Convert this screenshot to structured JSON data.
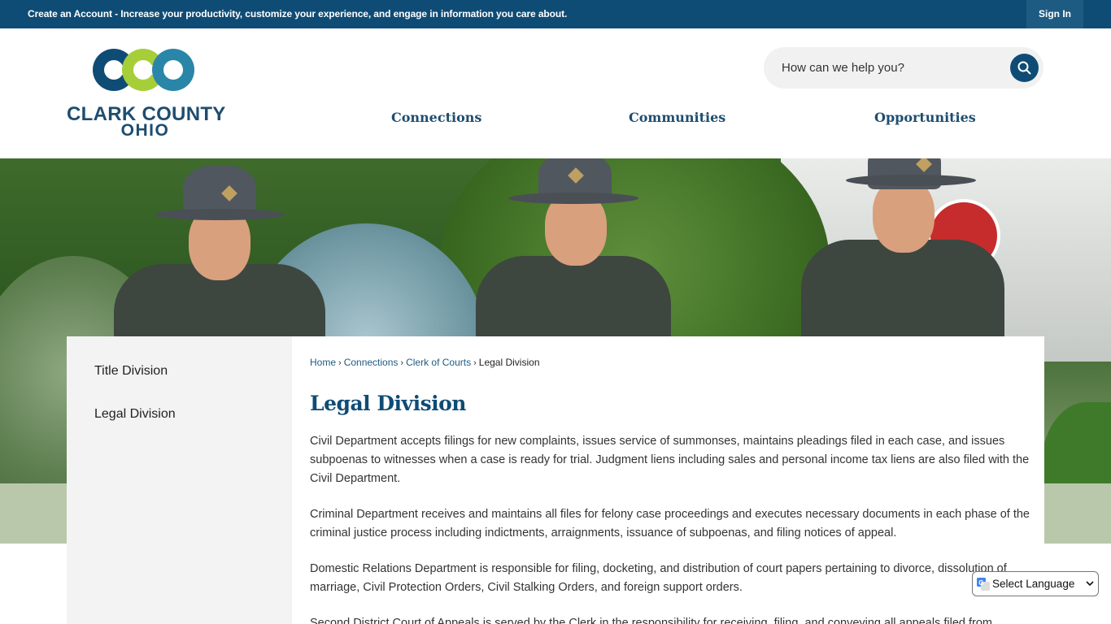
{
  "topbar": {
    "create_account": "Create an Account",
    "account_message": " - Increase your productivity, customize your experience, and engage in information you care about.",
    "sign_in": "Sign In"
  },
  "logo": {
    "line1": "CLARK COUNTY",
    "line2": "OHIO"
  },
  "search": {
    "placeholder": "How can we help you?",
    "icon": "search-icon"
  },
  "nav": {
    "items": [
      "Connections",
      "Communities",
      "Opportunities"
    ]
  },
  "sidebar": {
    "items": [
      "Title Division",
      "Legal Division"
    ]
  },
  "breadcrumb": {
    "items": [
      "Home",
      "Connections",
      "Clerk of Courts"
    ],
    "current": "Legal Division",
    "separator": "›"
  },
  "main": {
    "title": "Legal Division",
    "paragraphs": [
      "Civil Department accepts filings for new complaints, issues service of summonses, maintains pleadings filed in each case, and issues subpoenas to witnesses when a case is ready for trial. Judgment liens including sales and personal income tax liens are also filed with the Civil Department.",
      "Criminal Department receives and maintains all files for felony case proceedings and executes necessary documents in each phase of the criminal justice process including indictments, arraignments, issuance of subpoenas, and filing notices of appeal.",
      "Domestic Relations Department is responsible for filing, docketing, and distribution of court papers pertaining to divorce, dissolution of marriage, Civil Protection Orders, Civil Stalking Orders, and foreign support orders.",
      "Second District Court of Appeals is served by the Clerk in the responsibility for receiving, filing, and conveying all appeals filed from"
    ]
  },
  "translate": {
    "label": "Select Language"
  },
  "colors": {
    "primary": "#0f4c75",
    "accent_green": "#a6ce39",
    "accent_teal": "#2a86a8",
    "sidebar_bg": "#f3f3f3"
  }
}
